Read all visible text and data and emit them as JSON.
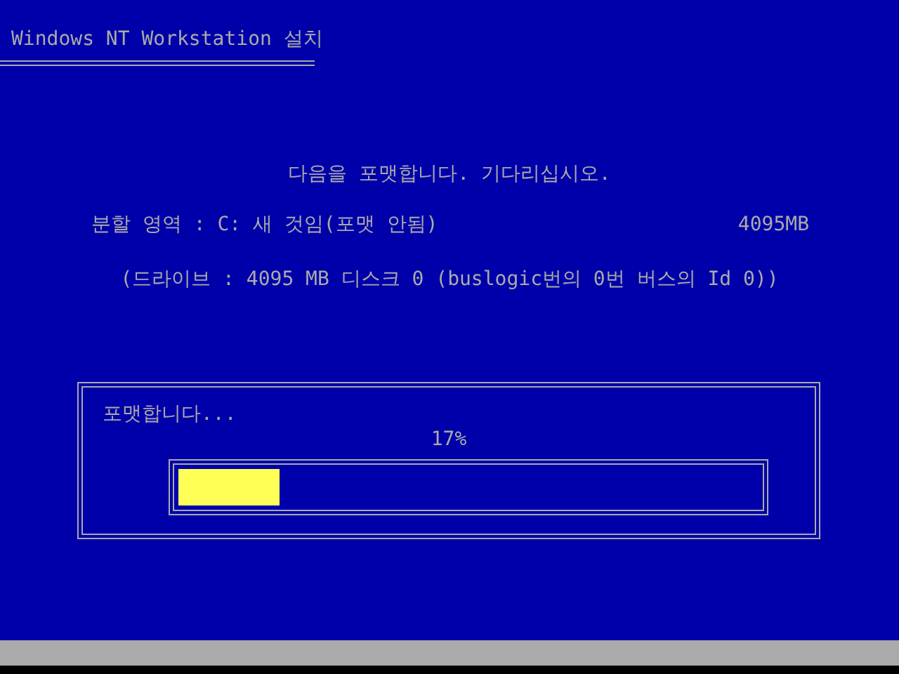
{
  "window": {
    "title": "Windows NT Workstation 설치"
  },
  "message": "다음을 포맷합니다. 기다리십시오.",
  "partition": {
    "label": "분할 영역 : C: 새 것임(포맷 안됨)",
    "size": "4095MB"
  },
  "drive": "(드라이브 : 4095 MB 디스크 0 (buslogic번의 0번 버스의 Id 0))",
  "progress": {
    "label": "포맷합니다...",
    "reading": "17%",
    "level": 0.17
  }
}
